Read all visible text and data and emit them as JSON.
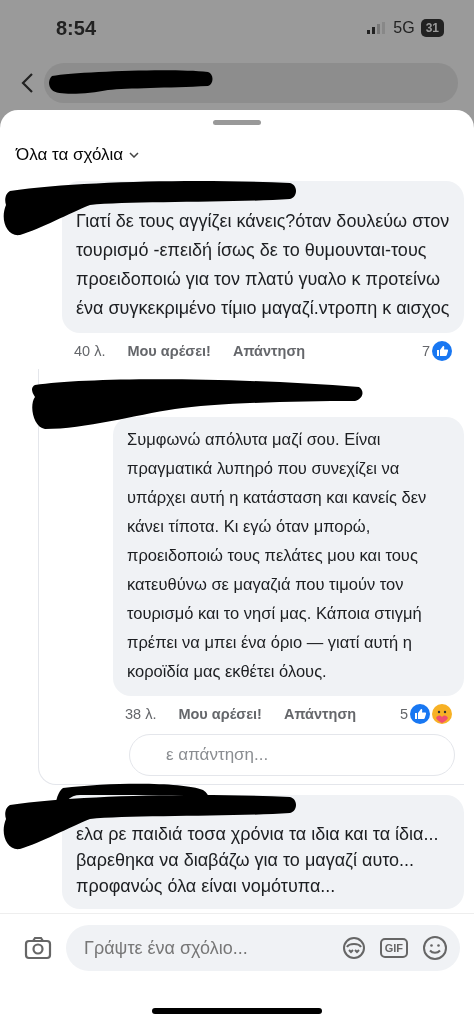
{
  "status_bar": {
    "time": "8:54",
    "network": "5G",
    "battery": "31"
  },
  "sheet": {
    "title": "Όλα τα σχόλια"
  },
  "comments": [
    {
      "text": "Γιατί δε τους αγγίζει κάνεις?όταν δουλεύω στον τουρισμό -επειδή ίσως δε το θυμουνται-τους προειδοποιώ για τον πλατύ γυαλο κ προτείνω ένα συγκεκριμένο τίμιο μαγαζί.ντροπη κ αισχος",
      "time": "40 λ.",
      "like_label": "Μου αρέσει!",
      "reply_label": "Απάντηση",
      "reaction_count": "7",
      "reactions": [
        {
          "kind": "like"
        }
      ],
      "replies": [
        {
          "text": "Συμφωνώ απόλυτα μαζί σου. Είναι πραγματικά λυπηρό που συνεχίζει να υπάρχει αυτή η κατάσταση και κανείς δεν κάνει τίποτα. Κι εγώ όταν μπορώ, προειδοποιώ τους πελάτες μου και τους κατευθύνω σε μαγαζιά που τιμούν τον τουρισμό και το νησί μας. Κάποια στιγμή πρέπει να μπει ένα όριο — γιατί αυτή η κοροϊδία μας εκθέτει όλους.",
          "time": "38 λ.",
          "like_label": "Μου αρέσει!",
          "reply_label": "Απάντηση",
          "reaction_count": "5",
          "reactions": [
            {
              "kind": "like"
            },
            {
              "kind": "care"
            }
          ]
        }
      ],
      "reply_field": {
        "placeholder": "ε απάντηση..."
      }
    },
    {
      "text": "ελα ρε παιδιά τοσα χρόνια τα ιδια και τα ίδια... βαρεθηκα να διαβάζω για το μαγαζί αυτο... προφανώς όλα είναι νομότυπα..."
    }
  ],
  "composer": {
    "placeholder": "Γράψτε ένα σχόλιο...",
    "gif_label": "GIF"
  }
}
